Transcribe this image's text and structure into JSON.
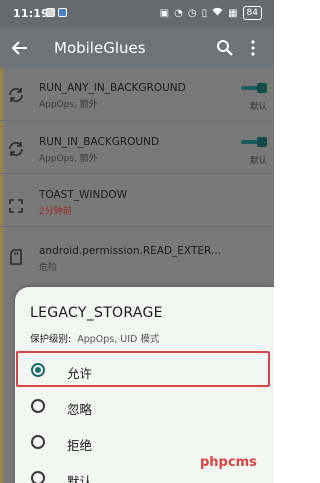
{
  "status_bar": {
    "time": "11:19",
    "battery": "84"
  },
  "app_bar": {
    "title": "MobileGlues"
  },
  "list": {
    "items": [
      {
        "name": "RUN_ANY_IN_BACKGROUND",
        "sub": "AppOps, 额外",
        "mode": "默认",
        "icon": "sync-icon"
      },
      {
        "name": "RUN_IN_BACKGROUND",
        "sub": "AppOps, 额外",
        "mode": "默认",
        "icon": "sync-icon"
      },
      {
        "name": "TOAST_WINDOW",
        "sub": "2分钟前",
        "icon": "fullscreen-icon"
      },
      {
        "name": "android.permission.READ_EXTER...",
        "sub": "危险",
        "icon": "sd-card-icon"
      }
    ]
  },
  "dialog": {
    "title": "LEGACY_STORAGE",
    "level_label": "保护级别:",
    "level_value": "AppOps, UID 模式",
    "options": [
      {
        "label": "允许",
        "selected": true
      },
      {
        "label": "忽略",
        "selected": false
      },
      {
        "label": "拒绝",
        "selected": false
      },
      {
        "label": "默认",
        "selected": false
      }
    ]
  },
  "watermark": "phpcms",
  "colors": {
    "accent": "#1b6b68",
    "highlight": "#d84545",
    "scrim": "#797979"
  }
}
